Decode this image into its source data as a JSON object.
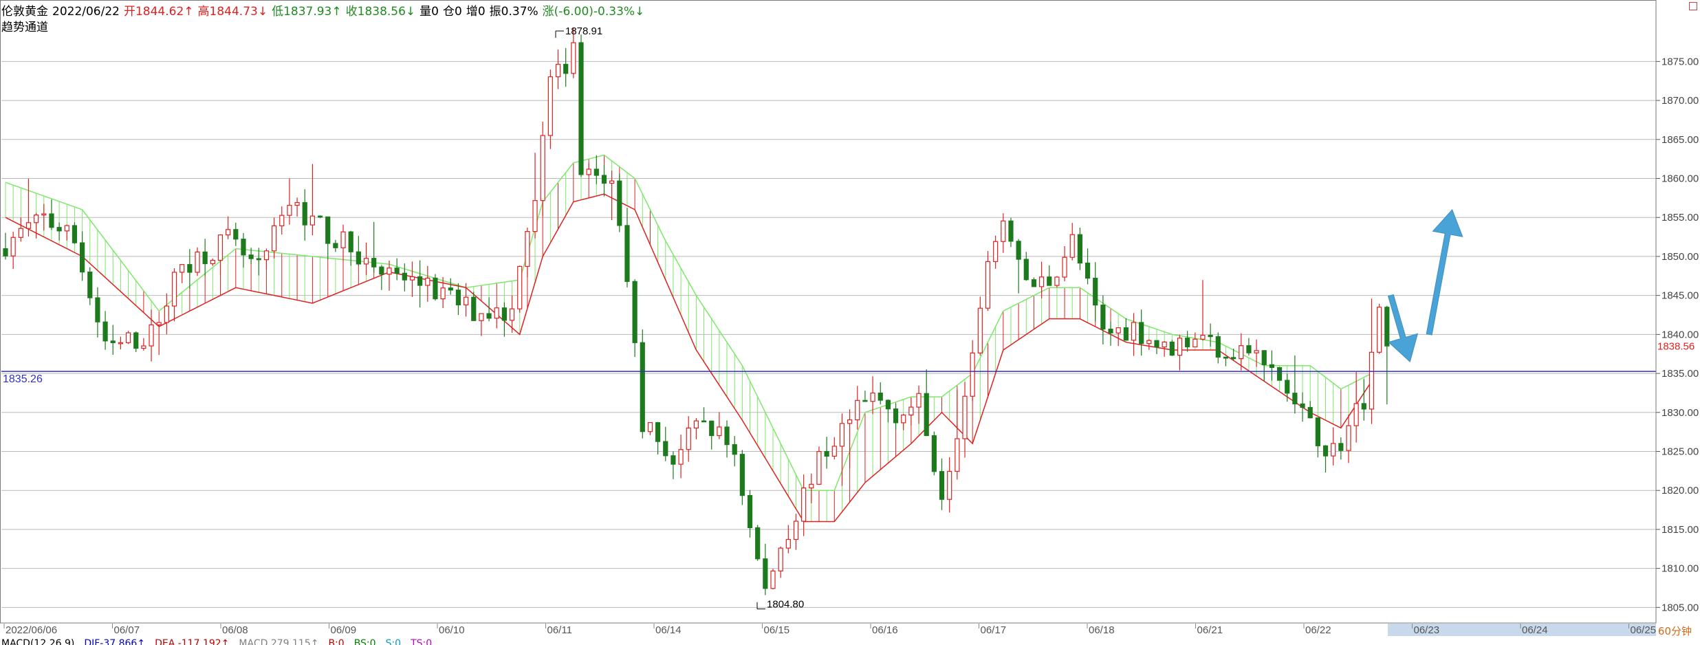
{
  "header": {
    "symbol": "伦敦黄金",
    "date": "2022/06/22",
    "open": "开1844.62↑",
    "high": "高1844.73↓",
    "low": "低1837.93↑",
    "close": "收1838.56↓",
    "volume": "量0",
    "position": "仓0",
    "increase": "增0",
    "amplitude": "振0.37%",
    "change": "涨(-6.00)-0.33%↓"
  },
  "indicator_label": "趋势通道",
  "period_label": "60分钟",
  "macd_bar": {
    "macd": "MACD(12,26,9)",
    "dif": "DIF-37.866↑",
    "dea": "DEA -117.192↑",
    "macd_val": "MACD 279.115↑",
    "b": "B:0",
    "bs": "BS:0",
    "s": "S:0",
    "ts": "TS:0"
  },
  "colors": {
    "up": "#e0201f",
    "down": "#1c7a1c",
    "channel_upper": "#7de86a",
    "channel_lower": "#e0201f",
    "hline": "#3030c0",
    "arrow": "#4aa3d6",
    "grid": "#b9b9b9"
  },
  "chart_data": {
    "type": "candlestick",
    "ylim": [
      1803,
      1882
    ],
    "y_ticks": [
      1805,
      1810,
      1815,
      1820,
      1825,
      1830,
      1835,
      1840,
      1845,
      1850,
      1855,
      1860,
      1865,
      1870,
      1875
    ],
    "y_tick_labels": [
      "1805.00",
      "1810.00",
      "1815.00",
      "1820.00",
      "1825.00",
      "1830.00",
      "1835.00",
      "1840.00",
      "1845.00",
      "1850.00",
      "1855.00",
      "1860.00",
      "1865.00",
      "1870.00",
      "1875.00"
    ],
    "x_labels": [
      "2022/06/06",
      "06/07",
      "06/08",
      "06/09",
      "06/10",
      "06/11",
      "06/14",
      "06/15",
      "06/16",
      "06/17",
      "06/18",
      "06/21",
      "06/22",
      "06/23",
      "06/24",
      "06/25"
    ],
    "current_price": "1838.56",
    "horizontal_line": {
      "value": 1835.26,
      "label": "1835.26"
    },
    "annotations": [
      {
        "label": "1878.91",
        "value": 1878.91
      },
      {
        "label": "1804.80",
        "value": 1804.8
      }
    ],
    "close_path": [
      [
        0,
        1851
      ],
      [
        6,
        1855
      ],
      [
        10,
        1852
      ],
      [
        14,
        1838
      ],
      [
        20,
        1840
      ],
      [
        24,
        1849
      ],
      [
        30,
        1852
      ],
      [
        34,
        1848
      ],
      [
        38,
        1857
      ],
      [
        43,
        1853
      ],
      [
        50,
        1848
      ],
      [
        56,
        1846
      ],
      [
        62,
        1843
      ],
      [
        67,
        1843
      ],
      [
        68,
        1850
      ],
      [
        70,
        1858
      ],
      [
        72,
        1872
      ],
      [
        75,
        1876
      ],
      [
        76,
        1862
      ],
      [
        80,
        1859
      ],
      [
        82,
        1848
      ],
      [
        84,
        1829
      ],
      [
        88,
        1824
      ],
      [
        92,
        1829
      ],
      [
        96,
        1825
      ],
      [
        98,
        1815
      ],
      [
        100,
        1807
      ],
      [
        102,
        1813
      ],
      [
        104,
        1817
      ],
      [
        106,
        1822
      ],
      [
        110,
        1828
      ],
      [
        114,
        1832
      ],
      [
        117,
        1830
      ],
      [
        120,
        1831
      ],
      [
        123,
        1820
      ],
      [
        126,
        1832
      ],
      [
        130,
        1853
      ],
      [
        132,
        1853
      ],
      [
        134,
        1846
      ],
      [
        137,
        1847
      ],
      [
        140,
        1852
      ],
      [
        144,
        1840
      ],
      [
        148,
        1841
      ],
      [
        152,
        1838
      ],
      [
        156,
        1840
      ],
      [
        160,
        1838
      ],
      [
        163,
        1838
      ],
      [
        167,
        1834
      ],
      [
        171,
        1828
      ],
      [
        174,
        1825
      ],
      [
        176,
        1828
      ],
      [
        178,
        1832
      ],
      [
        180,
        1844
      ],
      [
        181,
        1838
      ]
    ],
    "channel_upper_path": [
      [
        0,
        1859.5
      ],
      [
        10,
        1856
      ],
      [
        20,
        1843
      ],
      [
        30,
        1851
      ],
      [
        40,
        1850
      ],
      [
        50,
        1849
      ],
      [
        60,
        1846
      ],
      [
        67,
        1847
      ],
      [
        70,
        1857
      ],
      [
        74,
        1862
      ],
      [
        78,
        1863
      ],
      [
        82,
        1860
      ],
      [
        86,
        1852
      ],
      [
        90,
        1845
      ],
      [
        96,
        1836
      ],
      [
        104,
        1820
      ],
      [
        108,
        1820
      ],
      [
        112,
        1830
      ],
      [
        118,
        1832
      ],
      [
        122,
        1832
      ],
      [
        126,
        1835
      ],
      [
        130,
        1843
      ],
      [
        136,
        1846
      ],
      [
        140,
        1846
      ],
      [
        146,
        1842
      ],
      [
        152,
        1840
      ],
      [
        158,
        1839
      ],
      [
        164,
        1836
      ],
      [
        170,
        1836
      ],
      [
        174,
        1833
      ],
      [
        178,
        1835
      ]
    ],
    "channel_lower_path": [
      [
        0,
        1855
      ],
      [
        10,
        1850
      ],
      [
        20,
        1841
      ],
      [
        30,
        1846
      ],
      [
        40,
        1844
      ],
      [
        50,
        1848
      ],
      [
        60,
        1846
      ],
      [
        67,
        1840
      ],
      [
        70,
        1850
      ],
      [
        74,
        1857
      ],
      [
        78,
        1858
      ],
      [
        82,
        1856
      ],
      [
        86,
        1847
      ],
      [
        90,
        1838
      ],
      [
        96,
        1829
      ],
      [
        104,
        1816
      ],
      [
        108,
        1816
      ],
      [
        112,
        1821
      ],
      [
        118,
        1826
      ],
      [
        122,
        1830
      ],
      [
        126,
        1826
      ],
      [
        130,
        1838
      ],
      [
        136,
        1842
      ],
      [
        140,
        1842
      ],
      [
        146,
        1839
      ],
      [
        152,
        1838
      ],
      [
        158,
        1838
      ],
      [
        164,
        1834
      ],
      [
        170,
        1830
      ],
      [
        174,
        1828
      ],
      [
        178,
        1834
      ]
    ],
    "projection_arrows": [
      {
        "from": [
          1838.5,
          1845
        ],
        "to": [
          1841.0,
          1836.5
        ]
      },
      {
        "from": [
          1843.5,
          1840
        ],
        "to": [
          1846.5,
          1856
        ]
      }
    ]
  }
}
